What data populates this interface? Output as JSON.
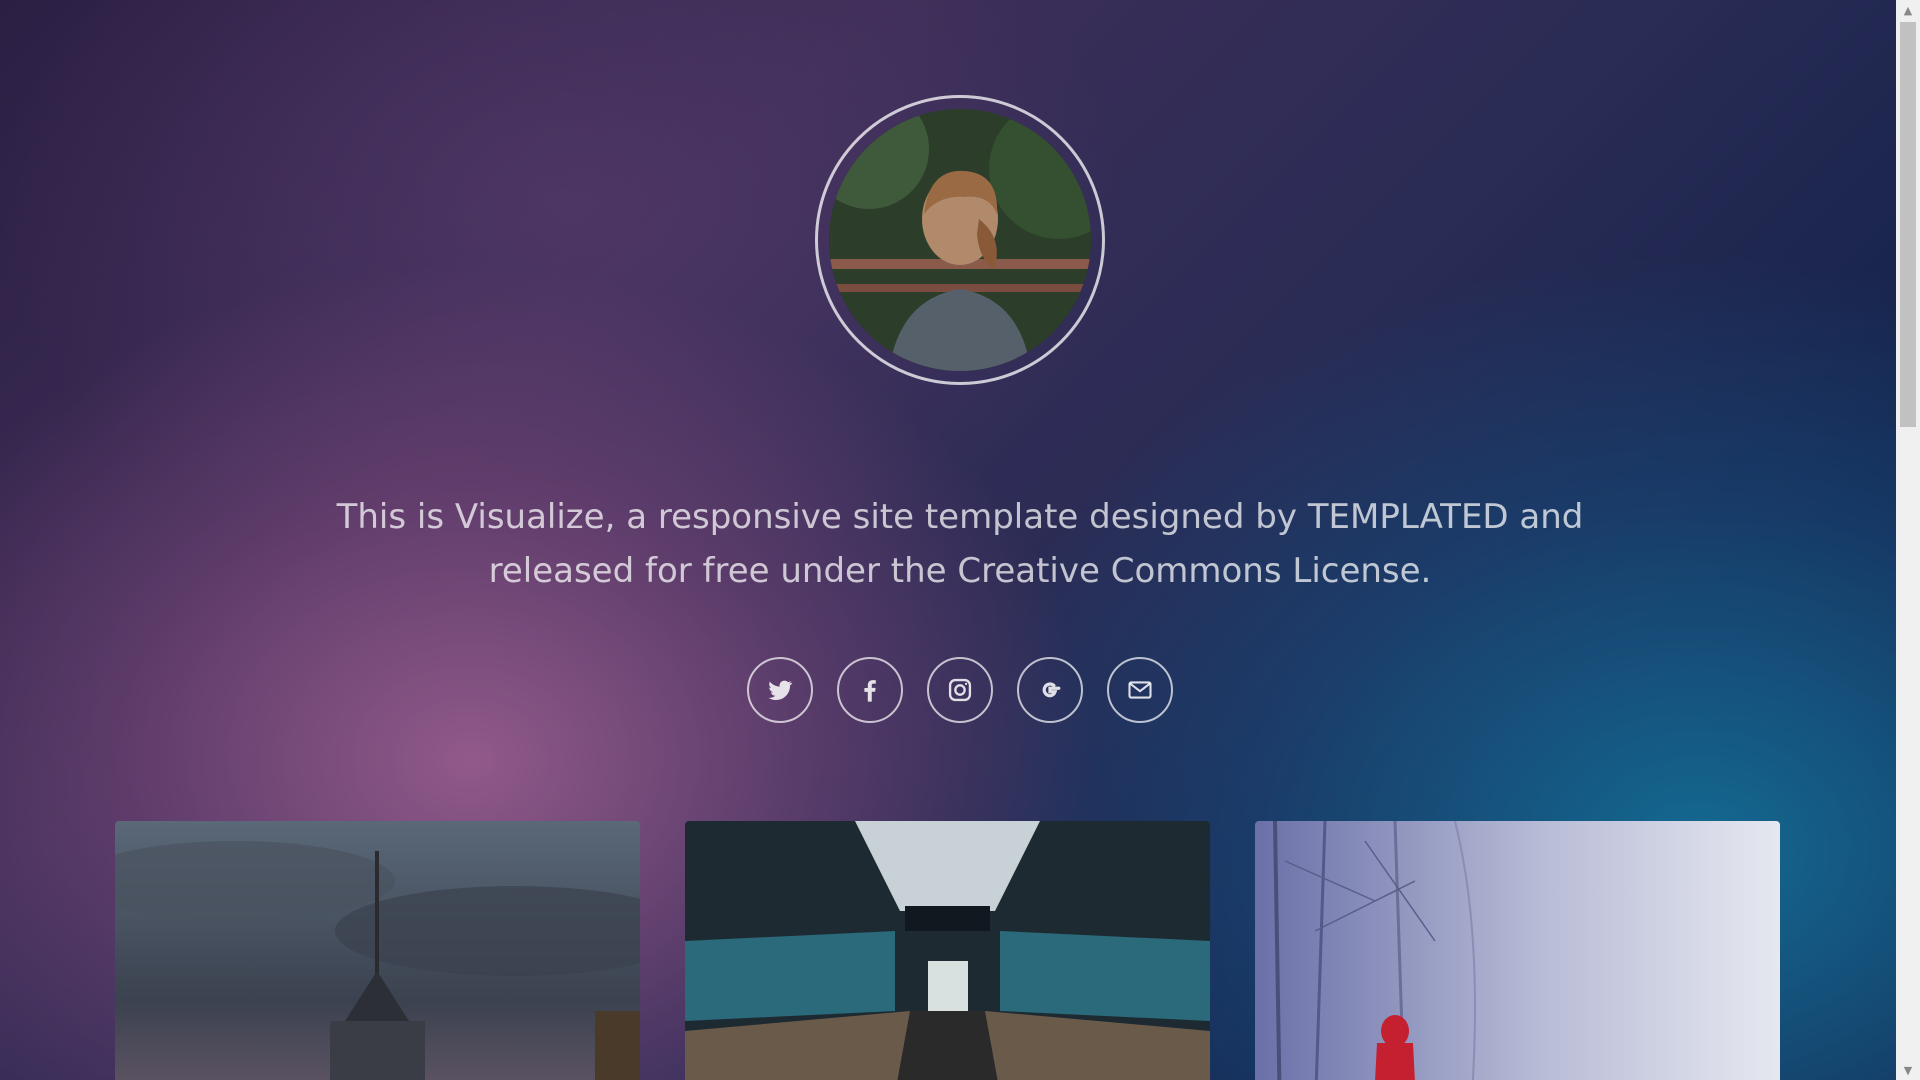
{
  "intro": {
    "text": "This is Visualize, a responsive site template designed by TEMPLATED and released for free under the Creative Commons License."
  },
  "avatar": {
    "icon": "avatar-photo"
  },
  "social": [
    {
      "name": "twitter-icon"
    },
    {
      "name": "facebook-icon"
    },
    {
      "name": "instagram-icon"
    },
    {
      "name": "google-icon"
    },
    {
      "name": "email-icon"
    }
  ],
  "gallery": [
    {
      "subject": "city skyline with spire tower at dusk"
    },
    {
      "subject": "escalator under skylight"
    },
    {
      "subject": "person in red coat in snowy forest"
    }
  ],
  "scrollbar": {
    "up_glyph": "▲",
    "down_glyph": "▼"
  },
  "colors": {
    "accent_pink": "#965c8c",
    "accent_teal": "#146e96",
    "text": "#ffffffb8"
  }
}
